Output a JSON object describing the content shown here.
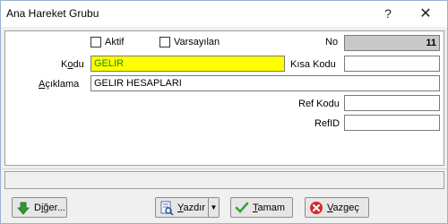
{
  "window": {
    "title": "Ana Hareket Grubu",
    "help_glyph": "?",
    "close_glyph": "✕"
  },
  "form": {
    "aktif_label": "Aktif",
    "varsayilan_label": "Varsayılan",
    "no_label": "No",
    "no_value": "11",
    "kodu_label_prefix": "K",
    "kodu_label_underlined": "o",
    "kodu_label_suffix": "du",
    "kodu_value": "GELIR",
    "kisa_kodu_label": "Kısa Kodu",
    "kisa_kodu_value": "",
    "aciklama_label_prefix": "",
    "aciklama_label_underlined": "A",
    "aciklama_label_suffix": "çıklama",
    "aciklama_value": "GELIR HESAPLARI",
    "ref_kodu_label": "Ref Kodu",
    "ref_kodu_value": "",
    "refid_label": "RefID",
    "refid_value": ""
  },
  "buttons": {
    "diger_prefix": "D",
    "diger_underlined": "i",
    "diger_suffix": "ğer...",
    "yazdir_prefix": "",
    "yazdir_underlined": "Y",
    "yazdir_suffix": "azdır",
    "tamam_prefix": "",
    "tamam_underlined": "T",
    "tamam_suffix": "amam",
    "vazgec_prefix": "",
    "vazgec_underlined": "V",
    "vazgec_suffix": "azgeç"
  },
  "colors": {
    "kodu_field_bg": "#ffff00",
    "kodu_text": "#1a8a1a",
    "no_field_bg": "#c8c8c8"
  }
}
